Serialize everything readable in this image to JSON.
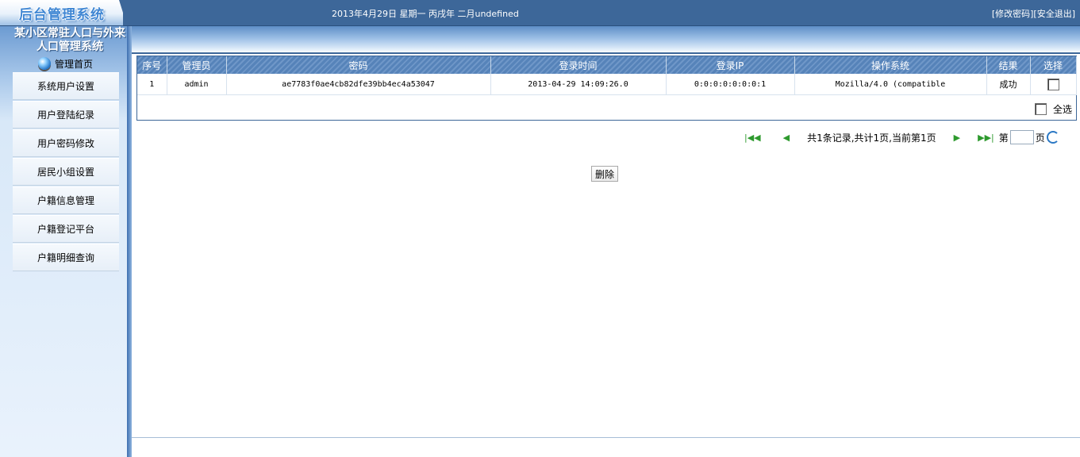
{
  "header": {
    "brand": "后台管理系统",
    "date_text": "2013年4月29日 星期一 丙戌年 二月undefined",
    "links": {
      "change_password": "[修改密码]",
      "logout": "[安全退出]"
    }
  },
  "sidebar": {
    "system_title_line1": "某小区常驻人口与外来",
    "system_title_line2": "人口管理系统",
    "home_label": "管理首页",
    "items": [
      {
        "label": "系统用户设置"
      },
      {
        "label": "用户登陆纪录"
      },
      {
        "label": "用户密码修改"
      },
      {
        "label": "居民小组设置"
      },
      {
        "label": "户籍信息管理"
      },
      {
        "label": "户籍登记平台"
      },
      {
        "label": "户籍明细查询"
      }
    ]
  },
  "table": {
    "columns": [
      "序号",
      "管理员",
      "密码",
      "登录时间",
      "登录IP",
      "操作系统",
      "结果",
      "选择"
    ],
    "rows": [
      [
        "1",
        "admin",
        "ae7783f0ae4cb82dfe39bb4ec4a53047",
        "2013-04-29 14:09:26.0",
        "0:0:0:0:0:0:0:1",
        "Mozilla/4.0 (compatible",
        "成功"
      ]
    ],
    "select_all_label": "全选"
  },
  "pager": {
    "summary": "共1条记录,共计1页,当前第1页",
    "page_prefix": "第",
    "page_suffix": "页",
    "page_value": ""
  },
  "actions": {
    "delete_label": "删除"
  }
}
